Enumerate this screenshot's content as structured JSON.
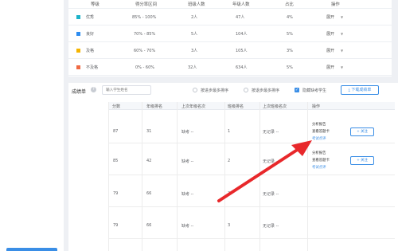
{
  "grade_table": {
    "headers": [
      "等级",
      "得分率区间",
      "班级人数",
      "年级人数",
      "占比",
      "操作"
    ],
    "rows": [
      {
        "level": "优秀",
        "range": "85% - 100%",
        "class_count": "2人",
        "grade_count": "47人",
        "ratio": "4%",
        "op": "展开",
        "color": "#1db3c9"
      },
      {
        "level": "良好",
        "range": "70% - 85%",
        "class_count": "5人",
        "grade_count": "104人",
        "ratio": "5%",
        "op": "展开",
        "color": "#2d8cf0"
      },
      {
        "level": "及格",
        "range": "60% - 70%",
        "class_count": "3人",
        "grade_count": "105人",
        "ratio": "3%",
        "op": "展开",
        "color": "#f5b400"
      },
      {
        "level": "不及格",
        "range": "0% - 60%",
        "class_count": "32人",
        "grade_count": "634人",
        "ratio": "5%",
        "op": "展开",
        "color": "#f06a44"
      }
    ]
  },
  "toolbar": {
    "title": "成绩单",
    "help": "?",
    "search_placeholder": "输入学生姓名",
    "radio1_label": "按进步最多排序",
    "radio2_label": "按退步最多排序",
    "checkbox_label": "隐藏缺考学生",
    "checkbox_mark": "✓",
    "download_label": "下载成绩单",
    "download_icon": "⤓"
  },
  "score_table": {
    "headers": [
      "分数",
      "年级排名",
      "上次年级名次",
      "班级排名",
      "上次班级名次",
      "操作"
    ],
    "rows": [
      {
        "score": "87",
        "rank": "31",
        "last_rank": "缺考 --",
        "class_rank": "1",
        "last_class_rank": "无记录 --",
        "actions": [
          "分析报告",
          "查看答题卡",
          "考试点评"
        ],
        "add": "+ 关注"
      },
      {
        "score": "85",
        "rank": "42",
        "last_rank": "缺考 --",
        "class_rank": "2",
        "last_class_rank": "无记录 --",
        "actions": [
          "分析报告",
          "查看答题卡",
          "考试点评"
        ],
        "add": "+ 关注"
      },
      {
        "score": "79",
        "rank": "66",
        "last_rank": "缺考 --",
        "class_rank": "3",
        "last_class_rank": "无记录 --",
        "actions": [],
        "add": ""
      },
      {
        "score": "79",
        "rank": "66",
        "last_rank": "缺考 --",
        "class_rank": "3",
        "last_class_rank": "无记录 --",
        "actions": [],
        "add": ""
      }
    ]
  },
  "colors": {
    "accent": "#3a8ee6",
    "arrow": "#e8282b"
  }
}
